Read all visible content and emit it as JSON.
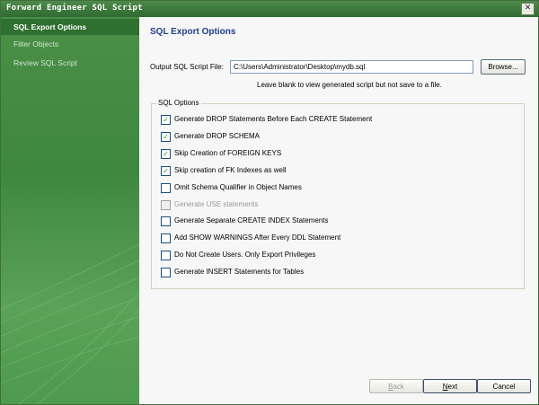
{
  "window": {
    "title": "Forward Engineer SQL Script",
    "close_glyph": "✕"
  },
  "sidebar": {
    "items": [
      {
        "label": "SQL Export Options",
        "active": true
      },
      {
        "label": "Filter Objects",
        "active": false
      },
      {
        "label": "Review SQL Script",
        "active": false
      }
    ]
  },
  "main": {
    "heading": "SQL Export Options",
    "output_label": "Output SQL Script File:",
    "output_value": "C:\\Users\\Administrator\\Desktop\\mydb.sql",
    "browse_label": "Browse...",
    "hint": "Leave blank to view generated script but not save to a file.",
    "options_legend": "SQL Options",
    "options": [
      {
        "label": "Generate DROP Statements Before Each CREATE Statement",
        "checked": true,
        "enabled": true
      },
      {
        "label": "Generate DROP SCHEMA",
        "checked": true,
        "enabled": true
      },
      {
        "label": "Skip Creation of FOREIGN KEYS",
        "checked": true,
        "enabled": true
      },
      {
        "label": "Skip creation of FK Indexes as well",
        "checked": true,
        "enabled": true
      },
      {
        "label": "Omit Schema Qualifier in Object Names",
        "checked": false,
        "enabled": true
      },
      {
        "label": "Generate USE statements",
        "checked": false,
        "enabled": false
      },
      {
        "label": "Generate Separate CREATE INDEX Statements",
        "checked": false,
        "enabled": true
      },
      {
        "label": "Add SHOW WARNINGS After Every DDL Statement",
        "checked": false,
        "enabled": true
      },
      {
        "label": "Do Not Create Users. Only Export Privileges",
        "checked": false,
        "enabled": true
      },
      {
        "label": "Generate INSERT Statements for Tables",
        "checked": false,
        "enabled": true
      }
    ]
  },
  "footer": {
    "back": {
      "first": "B",
      "rest": "ack"
    },
    "next": {
      "first": "N",
      "rest": "ext"
    },
    "cancel": "Cancel"
  },
  "colors": {
    "title_bar": "#2f6a32",
    "sidebar": "#4a8f46",
    "heading": "#1f3f8f",
    "check": "#21a121"
  }
}
